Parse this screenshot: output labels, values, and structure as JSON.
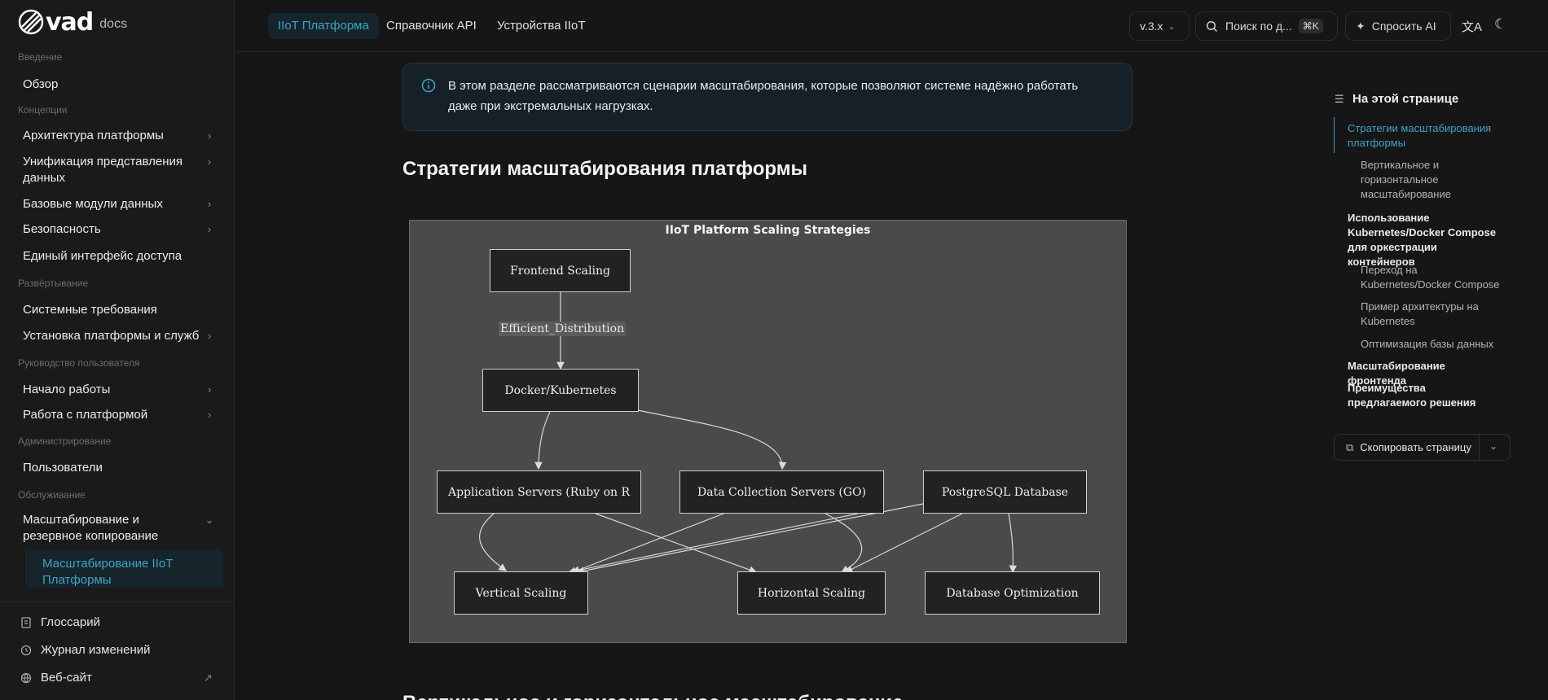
{
  "logo": {
    "word": "vad",
    "suffix": "docs"
  },
  "sidebar": {
    "sections": {
      "intro": "Введение",
      "concepts": "Концепции",
      "deploy": "Развёртывание",
      "guide": "Руководство пользователя",
      "admin": "Администрирование",
      "service": "Обслуживание"
    },
    "items": {
      "overview": "Обзор",
      "architecture": "Архитектура платформы",
      "unification": "Унификация представления данных",
      "base_modules": "Базовые модули данных",
      "security": "Безопасность",
      "single_access": "Единый интерфейс доступа",
      "requirements": "Системные требования",
      "install": "Установка платформы и служб",
      "getting_started": "Начало работы",
      "working": "Работа с платформой",
      "users": "Пользователи",
      "scaling_backup": "Масштабирование и резервное копирование",
      "scaling_iiot": "Масштабирование IIoT Платформы"
    },
    "bottom": {
      "glossary": "Глоссарий",
      "changelog": "Журнал изменений",
      "website": "Веб-сайт"
    }
  },
  "topbar": {
    "tabs": [
      "IIoT Платформа",
      "Справочник API",
      "Устройства IIoT"
    ],
    "version": "v.3.x",
    "search_placeholder": "Поиск по д...",
    "search_kbd": "⌘K",
    "ask_ai": "Спросить AI"
  },
  "content": {
    "callout": "В этом разделе рассматриваются сценарии масштабирования, которые позволяют системе надёжно работать даже при экстремальных нагрузках.",
    "heading": "Стратегии масштабирования платформы",
    "next_heading": "Вертикальное и горизонтальное масштабирование"
  },
  "diagram": {
    "title": "IIoT Platform Scaling Strategies",
    "nodes": {
      "frontend": "Frontend Scaling",
      "docker": "Docker/Kubernetes",
      "app": "Application Servers (Ruby on R",
      "data": "Data Collection Servers (GO)",
      "pg": "PostgreSQL Database",
      "vertical": "Vertical Scaling",
      "horizontal": "Horizontal Scaling",
      "dbopt": "Database Optimization"
    },
    "edge_label": "Efficient_Distribution"
  },
  "toc": {
    "title": "На этой странице",
    "items": [
      "Стратегии масштабирования платформы",
      "Вертикальное и горизонтальное масштабирование",
      "Использование Kubernetes/Docker Compose для оркестрации контейнеров",
      "Переход на Kubernetes/Docker Compose",
      "Пример архитектуры на Kubernetes",
      "Оптимизация базы данных",
      "Масштабирование фронтенда",
      "Преимущества предлагаемого решения"
    ],
    "copy": "Скопировать страницу"
  },
  "colors": {
    "accent": "#3da4c7",
    "background": "#161616",
    "sidebar": "#1a1a1a"
  }
}
